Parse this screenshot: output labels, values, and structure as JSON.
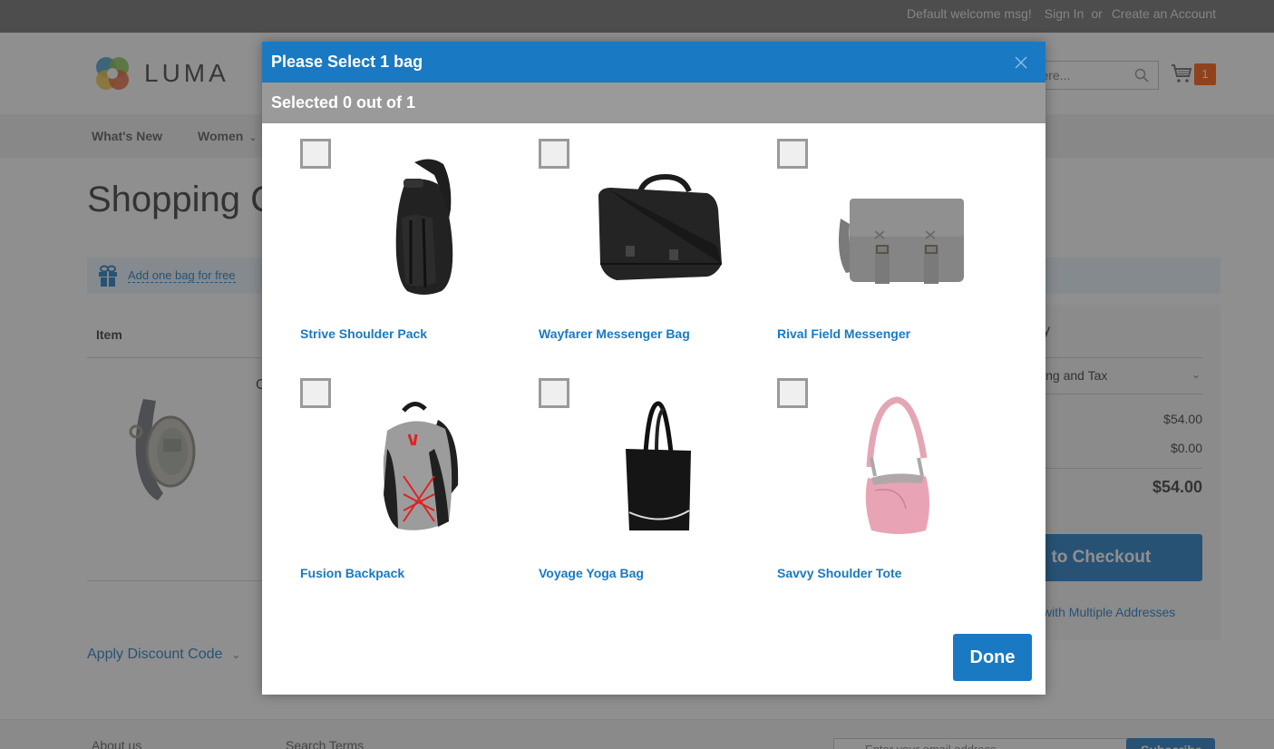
{
  "topbar": {
    "welcome": "Default welcome msg!",
    "sign_in": "Sign In",
    "or": "or",
    "create_account": "Create an Account"
  },
  "header": {
    "logo_text": "LUMA",
    "search_placeholder": "Search entire store here...",
    "search_visible_text": "e here...",
    "cart_count": "1"
  },
  "nav": {
    "items": [
      {
        "label": "What's New"
      },
      {
        "label": "Women"
      }
    ]
  },
  "page": {
    "title": "Shopping Cart",
    "title_visible": "Shopping C",
    "promo_link": "Add one bag for free",
    "table_header_item": "Item",
    "product_name_fragment": "C",
    "apply_discount": "Apply Discount Code"
  },
  "summary": {
    "title_fragment": "y",
    "shipping_tax_fragment": "ing and Tax",
    "subtotal": "$54.00",
    "discount": "$0.00",
    "order_total": "$54.00",
    "checkout_fragment": "ed to Checkout",
    "multi_address_fragment": "with Multiple Addresses"
  },
  "footer": {
    "about": "About us",
    "search_terms": "Search Terms",
    "newsletter_placeholder": "Enter your email address",
    "subscribe": "Subscribe"
  },
  "modal": {
    "title": "Please Select 1 bag",
    "subtitle": "Selected 0 out of 1",
    "done_label": "Done",
    "accent_color": "#1979c3",
    "products": [
      {
        "name": "Strive Shoulder Pack",
        "checked": false,
        "image": "black-sling-backpack"
      },
      {
        "name": "Wayfarer Messenger Bag",
        "checked": false,
        "image": "black-messenger-bag"
      },
      {
        "name": "Rival Field Messenger",
        "checked": false,
        "image": "gray-canvas-messenger"
      },
      {
        "name": "Fusion Backpack",
        "checked": false,
        "image": "gray-red-backpack"
      },
      {
        "name": "Voyage Yoga Bag",
        "checked": false,
        "image": "black-tote"
      },
      {
        "name": "Savvy Shoulder Tote",
        "checked": false,
        "image": "pink-shoulder-bag"
      }
    ]
  }
}
